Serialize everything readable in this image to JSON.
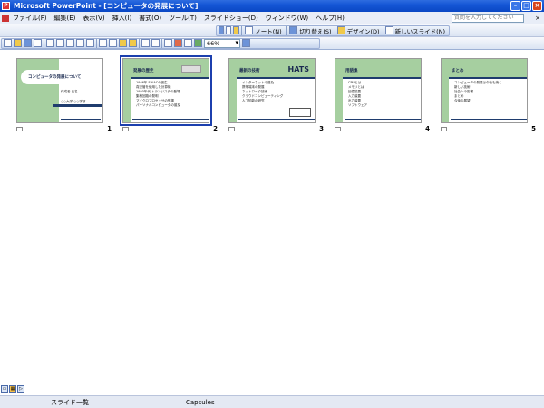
{
  "window": {
    "title": "Microsoft PowerPoint - [コンピュータの発展について]",
    "app_icon": "P"
  },
  "menu": {
    "items": [
      "ファイル(F)",
      "編集(E)",
      "表示(V)",
      "挿入(I)",
      "書式(O)",
      "ツール(T)",
      "スライドショー(D)",
      "ウィンドウ(W)",
      "ヘルプ(H)"
    ],
    "help_placeholder": "質問を入力してください"
  },
  "toolbar1": {
    "buttons": [
      "ノート(N)",
      "切り替え(S)",
      "デザイン(D)",
      "新しいスライド(N)"
    ]
  },
  "toolbar2": {
    "zoom": "66%"
  },
  "slides": [
    {
      "number": "1",
      "title": "コンピュータの発展について",
      "subtitle": "作成者 氏名",
      "sub2": "○○大学 ○○学部"
    },
    {
      "number": "2",
      "title": "発展の歴史",
      "lines": [
        "1946年 ENIACの誕生",
        "真空管を使用した計算機",
        "1950年代 トランジスタの登場",
        "集積回路の発明",
        "マイクロプロセッサの登場",
        "パーソナルコンピュータの普及"
      ]
    },
    {
      "number": "3",
      "title": "最新の技術",
      "big": "HATS",
      "lines": [
        "インターネットの普及",
        "携帯端末の発展",
        "ネットワーク技術",
        "クラウドコンピューティング",
        "人工知能の研究"
      ]
    },
    {
      "number": "4",
      "title": "用語集",
      "lines": [
        "CPUとは",
        "メモリとは",
        "記憶装置",
        "入力装置",
        "出力装置",
        "ソフトウェア"
      ]
    },
    {
      "number": "5",
      "title": "まとめ",
      "lines": [
        "コンピュータの発展は今後も続く",
        "新しい技術",
        "社会への影響",
        "まとめ",
        "今後の展望"
      ]
    }
  ],
  "status": {
    "view": "スライド一覧",
    "design": "Capsules"
  }
}
